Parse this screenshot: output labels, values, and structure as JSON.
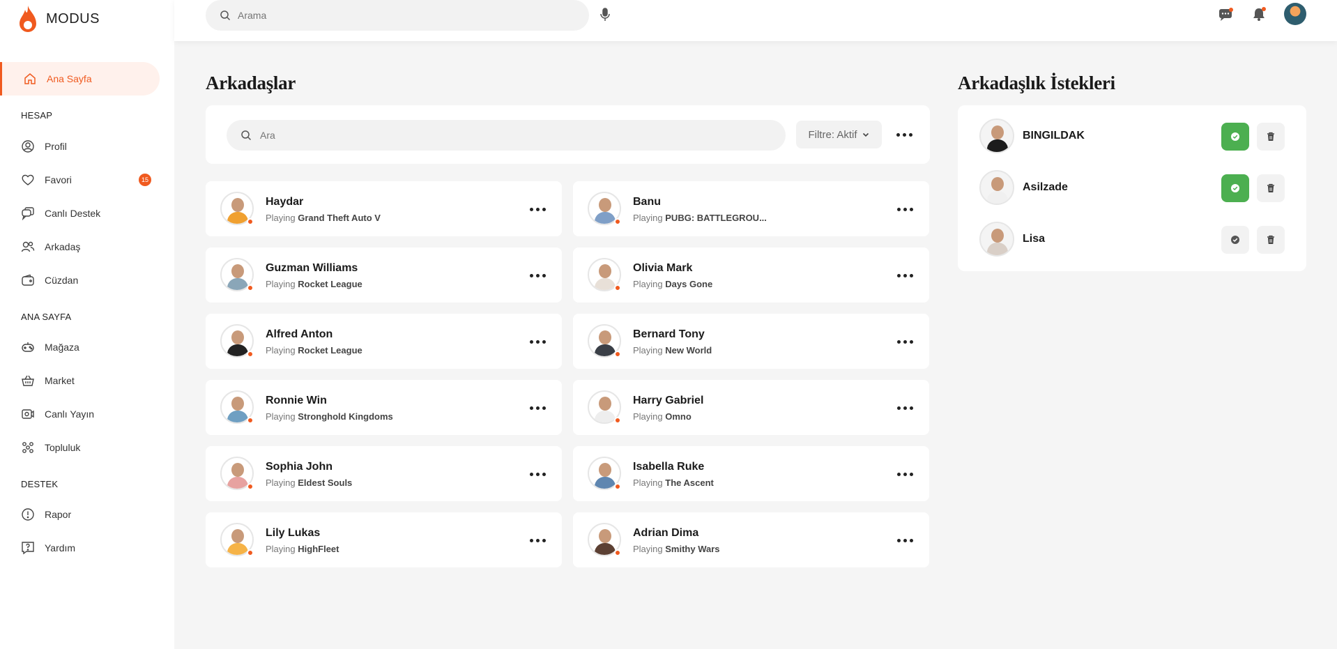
{
  "brand": {
    "name": "MODUS",
    "accent": "#f05a1f"
  },
  "topbar": {
    "search_placeholder": "Arama",
    "icons": [
      "message-icon",
      "bell-icon",
      "mic-icon"
    ]
  },
  "sidebar": {
    "active": {
      "label": "Ana Sayfa",
      "icon": "home-icon"
    },
    "sections": [
      {
        "title": "HESAP",
        "items": [
          {
            "label": "Profil",
            "icon": "user-icon"
          },
          {
            "label": "Favori",
            "icon": "heart-icon",
            "badge": "15"
          },
          {
            "label": "Canlı Destek",
            "icon": "chat-icon"
          },
          {
            "label": "Arkadaş",
            "icon": "users-icon"
          },
          {
            "label": "Cüzdan",
            "icon": "wallet-icon"
          }
        ]
      },
      {
        "title": "ANA SAYFA",
        "items": [
          {
            "label": "Mağaza",
            "icon": "gamepad-icon"
          },
          {
            "label": "Market",
            "icon": "basket-icon"
          },
          {
            "label": "Canlı Yayın",
            "icon": "live-icon"
          },
          {
            "label": "Topluluk",
            "icon": "community-icon"
          }
        ]
      },
      {
        "title": "DESTEK",
        "items": [
          {
            "label": "Rapor",
            "icon": "alert-icon"
          },
          {
            "label": "Yardım",
            "icon": "help-icon"
          }
        ]
      }
    ]
  },
  "friends": {
    "title": "Arkadaşlar",
    "search_placeholder": "Ara",
    "filter_label": "Filtre: Aktif",
    "playing_prefix": "Playing",
    "list": [
      {
        "name": "Haydar",
        "game": "Grand Theft Auto V",
        "shirt": "#f0a030"
      },
      {
        "name": "Banu",
        "game": "PUBG: BATTLEGROU...",
        "shirt": "#7f9fc7"
      },
      {
        "name": "Guzman Williams",
        "game": "Rocket League",
        "shirt": "#8aa6b8"
      },
      {
        "name": "Olivia Mark",
        "game": "Days Gone",
        "shirt": "#e8e0d8"
      },
      {
        "name": "Alfred Anton",
        "game": "Rocket League",
        "shirt": "#222222"
      },
      {
        "name": "Bernard Tony",
        "game": "New World",
        "shirt": "#3a3f47"
      },
      {
        "name": "Ronnie Win",
        "game": "Stronghold Kingdoms",
        "shirt": "#6f9fc2"
      },
      {
        "name": "Harry Gabriel",
        "game": "Omno",
        "shirt": "#eeeeee"
      },
      {
        "name": "Sophia John",
        "game": "Eldest Souls",
        "shirt": "#e7a2a0"
      },
      {
        "name": "Isabella Ruke",
        "game": "The Ascent",
        "shirt": "#5f86b0"
      },
      {
        "name": "Lily Lukas",
        "game": "HighFleet",
        "shirt": "#f6b347"
      },
      {
        "name": "Adrian Dima",
        "game": "Smithy Wars",
        "shirt": "#5c4033"
      }
    ]
  },
  "requests": {
    "title": "Arkadaşlık İstekleri",
    "list": [
      {
        "name": "BINGILDAK",
        "accepted_style": true,
        "shirt": "#1c1c1c"
      },
      {
        "name": "Asilzade",
        "accepted_style": true,
        "shirt": "#f0f0f0"
      },
      {
        "name": "Lisa",
        "accepted_style": false,
        "shirt": "#d9cfc7"
      }
    ],
    "accept_color": "#4caf50"
  }
}
